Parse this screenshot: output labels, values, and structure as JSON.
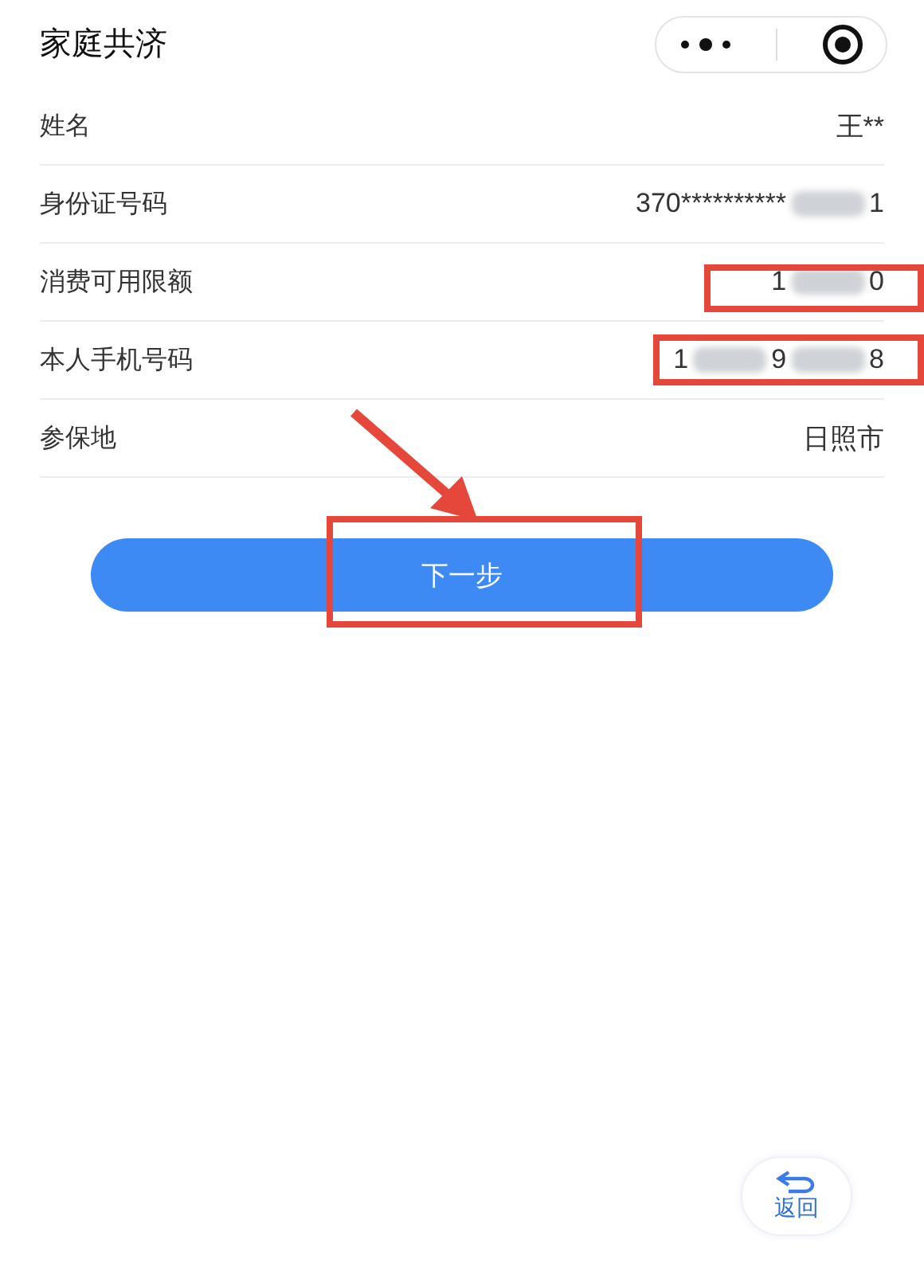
{
  "header": {
    "title": "家庭共济"
  },
  "rows": [
    {
      "label": "姓名",
      "value_parts": [
        "王**"
      ],
      "highlighted": false
    },
    {
      "label": "身份证号码",
      "value_parts": [
        "370**********",
        "1"
      ],
      "highlighted": false
    },
    {
      "label": "消费可用限额",
      "value_parts": [
        "1",
        "0"
      ],
      "highlighted": true
    },
    {
      "label": "本人手机号码",
      "value_parts": [
        "1",
        "9",
        "8"
      ],
      "highlighted": true
    },
    {
      "label": "参保地",
      "value_parts": [
        "日照市"
      ],
      "highlighted": false
    }
  ],
  "next_button": {
    "label": "下一步",
    "highlighted": true
  },
  "back_button": {
    "label": "返回"
  }
}
